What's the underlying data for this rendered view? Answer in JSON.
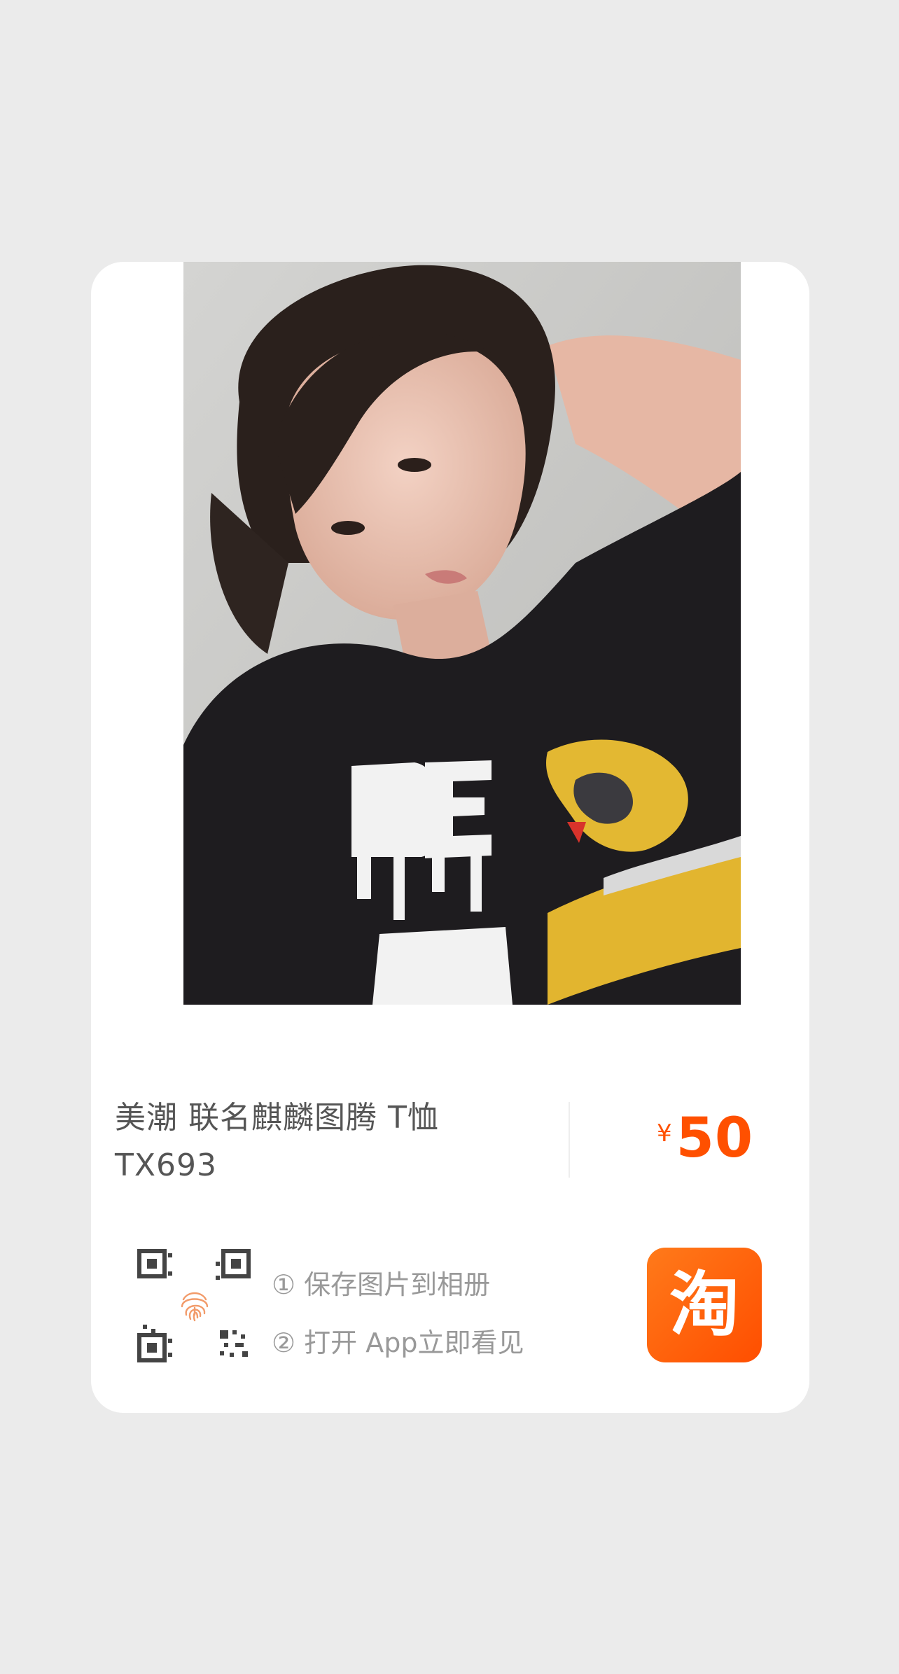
{
  "product": {
    "title_line1": "美潮 联名麒麟图腾 T恤",
    "title_line2": "TX693",
    "currency_symbol": "¥",
    "price": "50"
  },
  "instructions": {
    "step1": "① 保存图片到相册",
    "step2": "② 打开 App立即看见"
  },
  "app_button": {
    "glyph": "淘",
    "color": "#ff5000"
  },
  "icons": {
    "qr": "qr-code-icon",
    "fingerprint": "fingerprint-icon"
  },
  "colors": {
    "accent": "#ff5000",
    "background": "#ebebeb",
    "card": "#ffffff",
    "text": "#555555",
    "muted": "#999999"
  }
}
